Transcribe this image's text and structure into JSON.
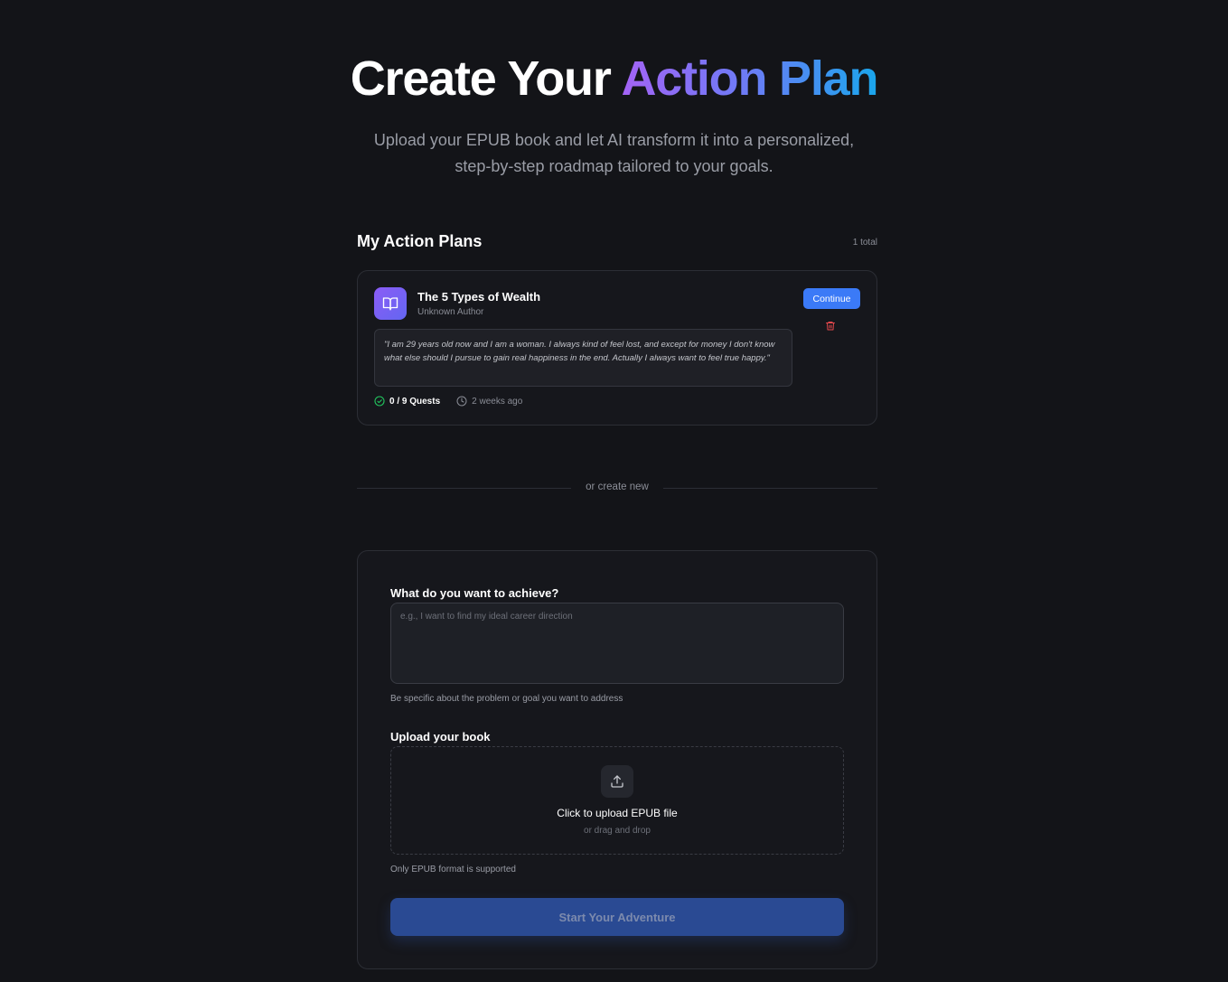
{
  "hero": {
    "title_plain": "Create Your ",
    "title_gradient": "Action Plan",
    "subtitle_line1": "Upload your EPUB book and let AI transform it into a personalized,",
    "subtitle_line2": "step-by-step roadmap tailored to your goals."
  },
  "plans_section": {
    "title": "My Action Plans",
    "count": "1 total"
  },
  "plans": [
    {
      "title": "The 5 Types of Wealth",
      "author": "Unknown Author",
      "continue_label": "Continue",
      "quote": "\"I am 29 years old now and I am a woman. I always kind of feel lost, and except for money I don't know what else should I pursue to gain real happiness in the end. Actually I always want to feel true happy.\"",
      "quests": "0 / 9 Quests",
      "updated": "2 weeks ago"
    }
  ],
  "divider_text": "or create new",
  "form": {
    "goal_label": "What do you want to achieve?",
    "goal_placeholder": "e.g., I want to find my ideal career direction",
    "goal_value": "",
    "goal_hint": "Be specific about the problem or goal you want to address",
    "upload_label": "Upload your book",
    "upload_main": "Click to upload EPUB file",
    "upload_sub": "or drag and drop",
    "upload_hint": "Only EPUB format is supported",
    "submit_label": "Start Your Adventure"
  },
  "colors": {
    "background": "#131418",
    "accent_blue": "#3b7af7",
    "gradient_start": "#a463f5",
    "gradient_end": "#1aa6ec",
    "danger": "#e5484d",
    "success": "#22c55e"
  },
  "icons": [
    "book-open-icon",
    "trash-icon",
    "check-circle-icon",
    "clock-icon",
    "upload-icon"
  ]
}
